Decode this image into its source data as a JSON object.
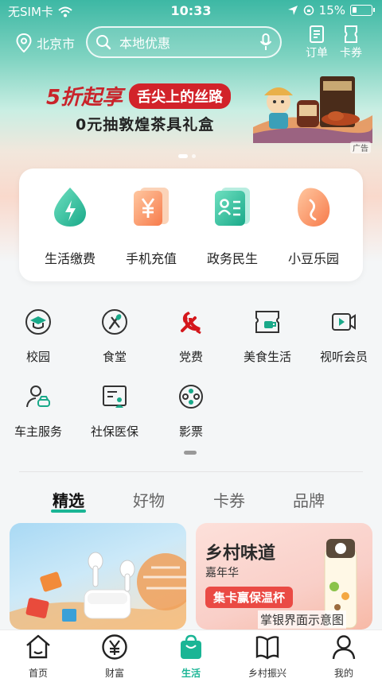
{
  "status_bar": {
    "carrier": "无SIM卡",
    "time": "10:33",
    "battery": "15%"
  },
  "header": {
    "city": "北京市",
    "search_placeholder": "本地优惠",
    "orders_label": "订单",
    "coupons_label": "卡券"
  },
  "banner": {
    "headline_prefix": "5折起享",
    "headline_tag": "舌尖上的丝路",
    "subline": "0元抽敦煌茶具礼盒",
    "ad_tag": "广告"
  },
  "main_services": [
    {
      "label": "生活缴费",
      "icon": "bolt-drop-icon"
    },
    {
      "label": "手机充值",
      "icon": "yen-card-icon"
    },
    {
      "label": "政务民生",
      "icon": "id-card-icon"
    },
    {
      "label": "小豆乐园",
      "icon": "bean-icon"
    }
  ],
  "services": [
    {
      "label": "校园",
      "icon": "graduation-cap-icon"
    },
    {
      "label": "食堂",
      "icon": "utensils-icon"
    },
    {
      "label": "党费",
      "icon": "party-emblem-icon"
    },
    {
      "label": "美食生活",
      "icon": "coffee-ticket-icon"
    },
    {
      "label": "视听会员",
      "icon": "video-play-icon"
    },
    {
      "label": "车主服务",
      "icon": "car-owner-icon"
    },
    {
      "label": "社保医保",
      "icon": "insurance-card-icon"
    },
    {
      "label": "影票",
      "icon": "film-reel-icon"
    }
  ],
  "content_tabs": [
    "精选",
    "好物",
    "卡券",
    "品牌"
  ],
  "feature_cards": {
    "right_title": "乡村味道",
    "right_subtitle": "嘉年华",
    "right_cta": "集卡赢保温杯",
    "watermark": "掌银界面示意图"
  },
  "tabbar": [
    {
      "label": "首页",
      "icon": "home-icon"
    },
    {
      "label": "财富",
      "icon": "yen-circle-icon"
    },
    {
      "label": "生活",
      "icon": "shopping-bag-icon"
    },
    {
      "label": "乡村振兴",
      "icon": "book-icon"
    },
    {
      "label": "我的",
      "icon": "user-icon"
    }
  ],
  "colors": {
    "accent": "#1ab595",
    "banner_red": "#c9232a",
    "party_red": "#d4171c"
  }
}
